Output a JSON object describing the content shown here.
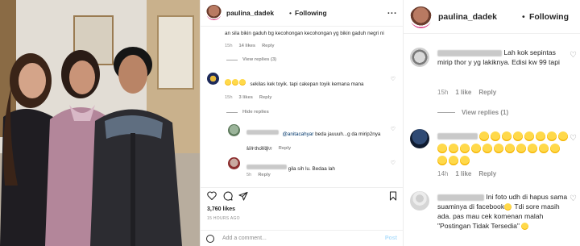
{
  "panel1": {
    "username": "paulina_dadek",
    "separator": "•",
    "follow": "Following",
    "more": "...",
    "comment0_text": "an sila bikin gaduh bg kecohongan kecohongan yg bikin gaduh negri ni",
    "comment0_meta": {
      "time": "15h",
      "likes": "14 likes",
      "reply": "Reply"
    },
    "view_replies_1": "View replies (3)",
    "comment1_text": "sekilas kek toyik. tapi cakepan toyik kemana mana",
    "comment1_meta": {
      "time": "15h",
      "likes": "3 likes",
      "reply": "Reply"
    },
    "hide_replies": "Hide replies",
    "reply1_mention": "@anitacahyar",
    "reply1_text": " beda jauuuh...g da mirip2nya sm thoriq...",
    "reply1_meta": {
      "time": "15h",
      "likes": "1 like",
      "reply": "Reply"
    },
    "reply2_text": " gila sih lu. Bedaa lah",
    "reply2_meta": {
      "time": "5h",
      "reply": "Reply"
    },
    "likes": "3,760 likes",
    "ago": "15 HOURS AGO",
    "add_comment": "Add a comment...",
    "post": "Post"
  },
  "panel2": {
    "username": "paulina_dadek",
    "separator": "•",
    "follow": "Following",
    "comment1_text": "Lah kok sepintas mirip thor y yg lakiknya. Edisi kw 99 tapi",
    "comment1_meta": {
      "time": "15h",
      "likes": "1 like",
      "reply": "Reply"
    },
    "view_replies": "View replies (1)",
    "comment2_meta": {
      "time": "14h",
      "likes": "1 like",
      "reply": "Reply"
    },
    "comment3_text": "Ini foto udh di hapus sama suaminya di facebook",
    "comment3_text2": " Tdi sore masih ada. pas mau cek komenan malah \"Postingan Tidak Tersedia\"",
    "heart": "♡"
  },
  "colors": {
    "text": "#262626",
    "muted": "#8e8e8e",
    "post_disabled": "#b2dffc",
    "accent_ring": "#d62976"
  }
}
